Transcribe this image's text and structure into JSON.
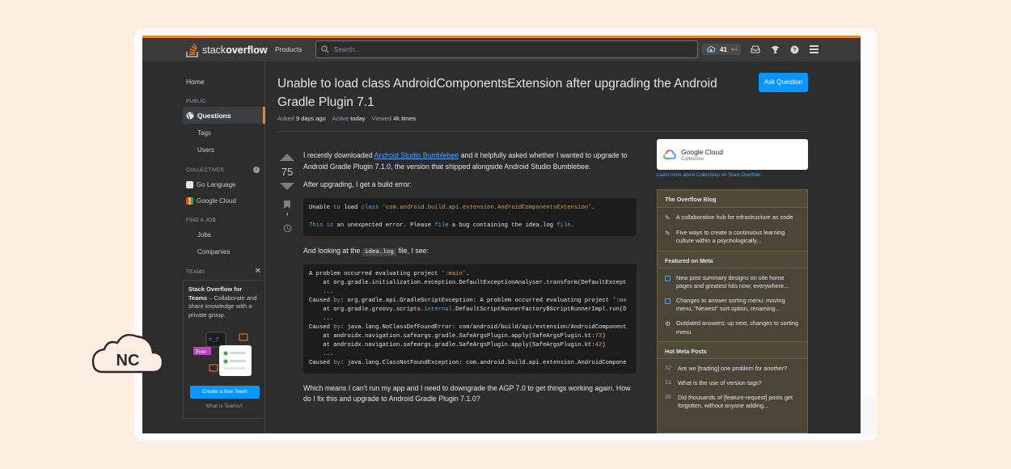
{
  "topbar": {
    "logo_stack": "stack",
    "logo_overflow": "overflow",
    "products": "Products",
    "search_placeholder": "Search...",
    "reputation": "41",
    "badge_count": "●4"
  },
  "leftnav": {
    "home": "Home",
    "public_label": "PUBLIC",
    "questions": "Questions",
    "tags": "Tags",
    "users": "Users",
    "collectives_label": "COLLECTIVES",
    "collective_1": "Go Language",
    "collective_2": "Google Cloud",
    "find_job_label": "FIND A JOB",
    "jobs": "Jobs",
    "companies": "Companies",
    "teams_label": "TEAMS",
    "teams_title": "Stack Overflow for Teams",
    "teams_desc": " – Collaborate and share knowledge with a private group.",
    "free_tag": "Free",
    "cta": "Create a free Team",
    "what_is": "What is Teams?"
  },
  "question": {
    "title": "Unable to load class AndroidComponentsExtension after upgrading the Android Gradle Plugin 7.1",
    "asked_label": "Asked",
    "asked_value": "9 days ago",
    "active_label": "Active",
    "active_value": "today",
    "viewed_label": "Viewed",
    "viewed_value": "4k times",
    "ask_button": "Ask Question",
    "votes": "75",
    "bookmarks": "4",
    "p1_a": "I recently downloaded ",
    "p1_link": "Android Studio Bumblebee",
    "p1_b": " and it helpfully asked whether I wanted to upgrade to Android Gradle Plugin 7.1.0, the version that shipped alongside Android Studio Bumblebee.",
    "p2": "After upgrading, I get a build error:",
    "p3_a": "And looking at the ",
    "p3_code": "idea.log",
    "p3_b": " file, I see:",
    "p4": "Which means I can't run my app and I need to downgrade the AGP 7.0 to get things working again. How do I fix this and upgrade to Android Gradle Plugin 7.1.0?"
  },
  "sidebar": {
    "collective_name": "Google Cloud",
    "collective_sub": "Collective",
    "learn_more": "Learn more about Collectives on Stack Overflow",
    "blog_header": "The Overflow Blog",
    "blog_1": "A collaborative hub for infrastructure as code",
    "blog_2": "Five ways to create a continuous learning culture within a psychologically...",
    "meta_header": "Featured on Meta",
    "meta_1": "New post summary designs on site home pages and greatest hits now; everywhere...",
    "meta_2": "Changes to answer sorting menu: moving menu, \"Newest\" sort option, renaming...",
    "meta_3": "Outdated answers: up next, changes to sorting menu",
    "hot_header": "Hot Meta Posts",
    "hot_1_num": "32",
    "hot_1": "Are we [trading] one problem for another?",
    "hot_2_num": "13",
    "hot_2": "What is the use of version tags?",
    "hot_3_num": "38",
    "hot_3": "Did thousands of [feature-request] posts get forgotten, without anyone adding..."
  },
  "overlay": {
    "nc": "NC"
  },
  "colors": {
    "accent": "#f48225",
    "primary": "#0a95ff",
    "background": "#2d2d2d"
  }
}
